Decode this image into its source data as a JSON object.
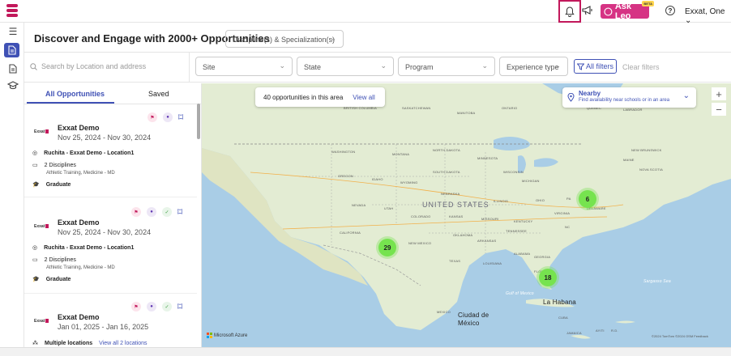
{
  "topbar": {
    "ask_leo_label": "Ask Leo",
    "beta_label": "BETA",
    "user_label": "Exxat, One"
  },
  "header": {
    "title": "Discover and Engage with 2000+ Opportunities",
    "discipline_select": "Discipline(s) & Specialization(s)"
  },
  "filters": {
    "search_placeholder": "Search by Location and address",
    "site": "Site",
    "state": "State",
    "program": "Program",
    "experience_type": "Experience type",
    "all_filters": "All filters",
    "clear_filters": "Clear filters"
  },
  "tabs": [
    "All Opportunities",
    "Saved"
  ],
  "cards": [
    {
      "logo": "Exxat",
      "name": "Exxat Demo",
      "dates": "Nov 25, 2024 - Nov 30, 2024",
      "location": "Ruchita - Exxat Demo - Location1",
      "disciplines": "2 Disciplines",
      "disciplines_detail": "Athletic Training, Medicine - MD",
      "level": "Graduate"
    },
    {
      "logo": "Exxat",
      "name": "Exxat Demo",
      "dates": "Nov 25, 2024 - Nov 30, 2024",
      "location": "Ruchita - Exxat Demo - Location1",
      "disciplines": "2 Disciplines",
      "disciplines_detail": "Athletic Training, Medicine - MD",
      "level": "Graduate"
    },
    {
      "logo": "Exxat",
      "name": "Exxat Demo",
      "dates": "Jan 01, 2025 - Jan 16, 2025",
      "location": "Multiple locations",
      "view_all": "View all 2 locations"
    }
  ],
  "map": {
    "opportunities_text": "40 opportunities in this area",
    "view_all": "View all",
    "nearby_title": "Nearby",
    "nearby_sub": "Find availability near schools or in an area",
    "clusters": [
      "29",
      "6",
      "18"
    ],
    "labels": {
      "us": "UNITED STATES",
      "gulf": "Gulf of Mexico",
      "sargasso": "Sargasso Sea",
      "cdmx": "Ciudad de México",
      "havana": "La Habana",
      "mexico": "MEXICO",
      "cuba": "CUBA",
      "jamaica": "JAMAICA",
      "haiti": "AYITI",
      "dr": "R.D.",
      "manitoba": "MANITOBA",
      "saskatchewan": "SASKATCHEWAN",
      "ontario": "ONTARIO",
      "quebec": "QUEBEC",
      "newfoundland": "NEWFOUNDLAND AND LABRADOR",
      "britishcolumbia": "BRITISH COLUMBIA",
      "washington": "WASHINGTON",
      "montana": "MONTANA",
      "northdakota": "NORTH DAKOTA",
      "minnesota": "MINNESOTA",
      "oregon": "OREGON",
      "idaho": "IDAHO",
      "southdakota": "SOUTH DAKOTA",
      "wisconsin": "WISCONSIN",
      "michigan": "MICHIGAN",
      "wyoming": "WYOMING",
      "nebraska": "NEBRASKA",
      "nevada": "NEVADA",
      "utah": "UTAH",
      "colorado": "COLORADO",
      "kansas": "KANSAS",
      "missouri": "MISSOURI",
      "illinois": "ILLINOIS",
      "ohio": "OHIO",
      "california": "CALIFORNIA",
      "newmexico": "NEW MEXICO",
      "oklahoma": "OKLAHOMA",
      "arkansas": "ARKANSAS",
      "tennessee": "TENNESSEE",
      "kentucky": "KENTUCKY",
      "virginia": "VIRGINIA",
      "nc": "NC",
      "texas": "TEXAS",
      "louisiana": "LOUISIANA",
      "alabama": "ALABAMA",
      "georgia": "GEORGIA",
      "florida": "FLORIDA",
      "pa": "PA",
      "maine": "MAINE",
      "novascotia": "NOVA SCOTIA",
      "newbrunswick": "NEW BRUNSWICK",
      "delaware": "DELAWARE"
    },
    "attribution_left": "Microsoft Azure",
    "attribution_right": "©2024 TomTom ©2024 OSM Feedback"
  },
  "colors": {
    "accent": "#3f51b5",
    "brand": "#c2185b",
    "cluster": "#76e34f"
  }
}
